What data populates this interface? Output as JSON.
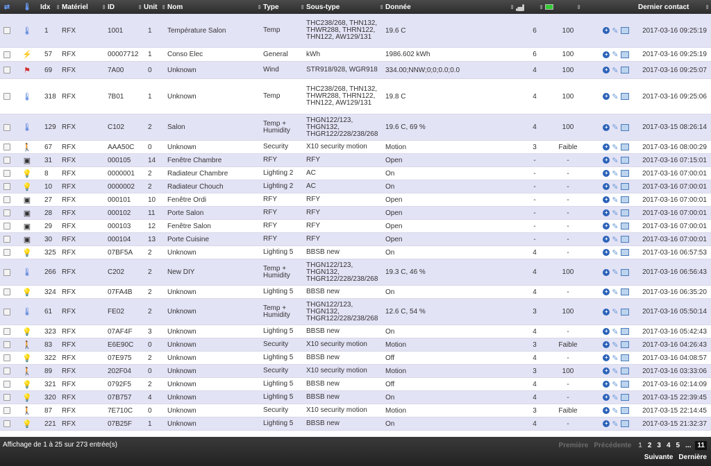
{
  "header": {
    "icons": [
      "sort-icon",
      "thermometer-icon"
    ],
    "idx": "Idx",
    "materiel": "Matériel",
    "id": "ID",
    "unit": "Unit",
    "nom": "Nom",
    "type": "Type",
    "soustype": "Sous-type",
    "donnee": "Donnée",
    "signal_icon": "signal-icon",
    "battery_icon": "battery-icon",
    "dernier": "Dernier contact"
  },
  "rows": [
    {
      "icon": "thermometer-icon",
      "idx": "1",
      "mat": "RFX",
      "id": "1001",
      "unit": "1",
      "nom": "Température Salon",
      "type": "Temp",
      "sous": "THC238/268, THN132, THWR288, THRN122, THN122, AW129/131",
      "donnee": "19.6 C",
      "sig": "6",
      "bat": "100",
      "date": "2017-03-16 09:25:19",
      "h": 49
    },
    {
      "icon": "power-icon",
      "idx": "57",
      "mat": "RFX",
      "id": "00007712",
      "unit": "1",
      "nom": "Conso Elec",
      "type": "General",
      "sous": "kWh",
      "donnee": "1986.602 kWh",
      "sig": "6",
      "bat": "100",
      "date": "2017-03-16 09:25:19",
      "h": 20
    },
    {
      "icon": "wind-icon",
      "idx": "69",
      "mat": "RFX",
      "id": "7A00",
      "unit": "0",
      "nom": "Unknown",
      "type": "Wind",
      "sous": "STR918/928, WGR918",
      "donnee": "334.00;NNW;0;0;0.0;0.0",
      "sig": "4",
      "bat": "100",
      "date": "2017-03-16 09:25:07",
      "h": 25
    },
    {
      "icon": "thermometer-icon",
      "idx": "318",
      "mat": "RFX",
      "id": "7B01",
      "unit": "1",
      "nom": "Unknown",
      "type": "Temp",
      "sous": "THC238/268, THN132, THWR288, THRN122, THN122, AW129/131",
      "donnee": "19.8 C",
      "sig": "4",
      "bat": "100",
      "date": "2017-03-16 09:25:06",
      "h": 51
    },
    {
      "icon": "thermometer-icon",
      "idx": "129",
      "mat": "RFX",
      "id": "C102",
      "unit": "2",
      "nom": "Salon",
      "type": "Temp + Humidity",
      "sous": "THGN122/123, THGN132, THGR122/228/238/268",
      "donnee": "19.6 C, 69 %",
      "sig": "4",
      "bat": "100",
      "date": "2017-03-15 08:26:14",
      "h": 38
    },
    {
      "icon": "motion-icon",
      "idx": "67",
      "mat": "RFX",
      "id": "AAA50C",
      "unit": "0",
      "nom": "Unknown",
      "type": "Security",
      "sous": "X10 security motion",
      "donnee": "Motion",
      "sig": "3",
      "bat": "Faible",
      "date": "2017-03-16 08:00:29",
      "h": 19
    },
    {
      "icon": "window-icon",
      "idx": "31",
      "mat": "RFX",
      "id": "000105",
      "unit": "14",
      "nom": "Fenêtre Chambre",
      "type": "RFY",
      "sous": "RFY",
      "donnee": "Open",
      "sig": "-",
      "bat": "-",
      "date": "2017-03-16 07:15:01",
      "h": 19
    },
    {
      "icon": "bulb-icon",
      "idx": "8",
      "mat": "RFX",
      "id": "0000001",
      "unit": "2",
      "nom": "Radiateur Chambre",
      "type": "Lighting 2",
      "sous": "AC",
      "donnee": "On",
      "sig": "-",
      "bat": "-",
      "date": "2017-03-16 07:00:01",
      "h": 19
    },
    {
      "icon": "bulb-icon",
      "idx": "10",
      "mat": "RFX",
      "id": "0000002",
      "unit": "2",
      "nom": "Radiateur Chouch",
      "type": "Lighting 2",
      "sous": "AC",
      "donnee": "On",
      "sig": "-",
      "bat": "-",
      "date": "2017-03-16 07:00:01",
      "h": 19
    },
    {
      "icon": "window-icon",
      "idx": "27",
      "mat": "RFX",
      "id": "000101",
      "unit": "10",
      "nom": "Fenêtre Ordi",
      "type": "RFY",
      "sous": "RFY",
      "donnee": "Open",
      "sig": "-",
      "bat": "-",
      "date": "2017-03-16 07:00:01",
      "h": 19
    },
    {
      "icon": "window-icon",
      "idx": "28",
      "mat": "RFX",
      "id": "000102",
      "unit": "11",
      "nom": "Porte Salon",
      "type": "RFY",
      "sous": "RFY",
      "donnee": "Open",
      "sig": "-",
      "bat": "-",
      "date": "2017-03-16 07:00:01",
      "h": 19
    },
    {
      "icon": "window-icon",
      "idx": "29",
      "mat": "RFX",
      "id": "000103",
      "unit": "12",
      "nom": "Fenêtre Salon",
      "type": "RFY",
      "sous": "RFY",
      "donnee": "Open",
      "sig": "-",
      "bat": "-",
      "date": "2017-03-16 07:00:01",
      "h": 19
    },
    {
      "icon": "window-icon",
      "idx": "30",
      "mat": "RFX",
      "id": "000104",
      "unit": "13",
      "nom": "Porte Cuisine",
      "type": "RFY",
      "sous": "RFY",
      "donnee": "Open",
      "sig": "-",
      "bat": "-",
      "date": "2017-03-16 07:00:01",
      "h": 19
    },
    {
      "icon": "bulb-icon",
      "idx": "325",
      "mat": "RFX",
      "id": "07BF5A",
      "unit": "2",
      "nom": "Unknown",
      "type": "Lighting 5",
      "sous": "BBSB new",
      "donnee": "On",
      "sig": "4",
      "bat": "-",
      "date": "2017-03-16 06:57:53",
      "h": 19
    },
    {
      "icon": "thermometer-icon",
      "idx": "266",
      "mat": "RFX",
      "id": "C202",
      "unit": "2",
      "nom": "New DIY",
      "type": "Temp + Humidity",
      "sous": "THGN122/123, THGN132, THGR122/228/238/268",
      "donnee": "19.3 C, 46 %",
      "sig": "4",
      "bat": "100",
      "date": "2017-03-16 06:56:43",
      "h": 38
    },
    {
      "icon": "bulb-icon",
      "idx": "324",
      "mat": "RFX",
      "id": "07FA4B",
      "unit": "2",
      "nom": "Unknown",
      "type": "Lighting 5",
      "sous": "BBSB new",
      "donnee": "On",
      "sig": "4",
      "bat": "-",
      "date": "2017-03-16 06:35:20",
      "h": 19
    },
    {
      "icon": "thermometer-icon",
      "idx": "61",
      "mat": "RFX",
      "id": "FE02",
      "unit": "2",
      "nom": "Unknown",
      "type": "Temp + Humidity",
      "sous": "THGN122/123, THGN132, THGR122/228/238/268",
      "donnee": "12.6 C, 54 %",
      "sig": "3",
      "bat": "100",
      "date": "2017-03-16 05:50:14",
      "h": 38
    },
    {
      "icon": "bulb-icon",
      "idx": "323",
      "mat": "RFX",
      "id": "07AF4F",
      "unit": "3",
      "nom": "Unknown",
      "type": "Lighting 5",
      "sous": "BBSB new",
      "donnee": "On",
      "sig": "4",
      "bat": "-",
      "date": "2017-03-16 05:42:43",
      "h": 19
    },
    {
      "icon": "motion-icon",
      "idx": "83",
      "mat": "RFX",
      "id": "E6E90C",
      "unit": "0",
      "nom": "Unknown",
      "type": "Security",
      "sous": "X10 security motion",
      "donnee": "Motion",
      "sig": "3",
      "bat": "Faible",
      "date": "2017-03-16 04:26:43",
      "h": 19
    },
    {
      "icon": "bulb-off-icon",
      "idx": "322",
      "mat": "RFX",
      "id": "07E975",
      "unit": "2",
      "nom": "Unknown",
      "type": "Lighting 5",
      "sous": "BBSB new",
      "donnee": "Off",
      "sig": "4",
      "bat": "-",
      "date": "2017-03-16 04:08:57",
      "h": 19
    },
    {
      "icon": "motion-icon",
      "idx": "89",
      "mat": "RFX",
      "id": "202F04",
      "unit": "0",
      "nom": "Unknown",
      "type": "Security",
      "sous": "X10 security motion",
      "donnee": "Motion",
      "sig": "3",
      "bat": "100",
      "date": "2017-03-16 03:33:06",
      "h": 19
    },
    {
      "icon": "bulb-off-icon",
      "idx": "321",
      "mat": "RFX",
      "id": "0792F5",
      "unit": "2",
      "nom": "Unknown",
      "type": "Lighting 5",
      "sous": "BBSB new",
      "donnee": "Off",
      "sig": "4",
      "bat": "-",
      "date": "2017-03-16 02:14:09",
      "h": 19
    },
    {
      "icon": "bulb-icon",
      "idx": "320",
      "mat": "RFX",
      "id": "07B757",
      "unit": "4",
      "nom": "Unknown",
      "type": "Lighting 5",
      "sous": "BBSB new",
      "donnee": "On",
      "sig": "4",
      "bat": "-",
      "date": "2017-03-15 22:39:45",
      "h": 19
    },
    {
      "icon": "motion-icon",
      "idx": "87",
      "mat": "RFX",
      "id": "7E710C",
      "unit": "0",
      "nom": "Unknown",
      "type": "Security",
      "sous": "X10 security motion",
      "donnee": "Motion",
      "sig": "3",
      "bat": "Faible",
      "date": "2017-03-15 22:14:45",
      "h": 19
    },
    {
      "icon": "bulb-icon",
      "idx": "221",
      "mat": "RFX",
      "id": "07B25F",
      "unit": "1",
      "nom": "Unknown",
      "type": "Lighting 5",
      "sous": "BBSB new",
      "donnee": "On",
      "sig": "4",
      "bat": "-",
      "date": "2017-03-15 21:32:37",
      "h": 19
    }
  ],
  "footer": {
    "info": "Affichage de 1 à 25 sur 273 entrée(s)",
    "premiere": "Première",
    "precedente": "Précédente",
    "pages": [
      "1",
      "2",
      "3",
      "4",
      "5",
      "...",
      "11"
    ],
    "suivante": "Suivante",
    "derniere": "Dernière"
  },
  "colors": {
    "odd_row": "#e3e3f6",
    "header": "#333333",
    "action_blue": "#2b62b8"
  }
}
